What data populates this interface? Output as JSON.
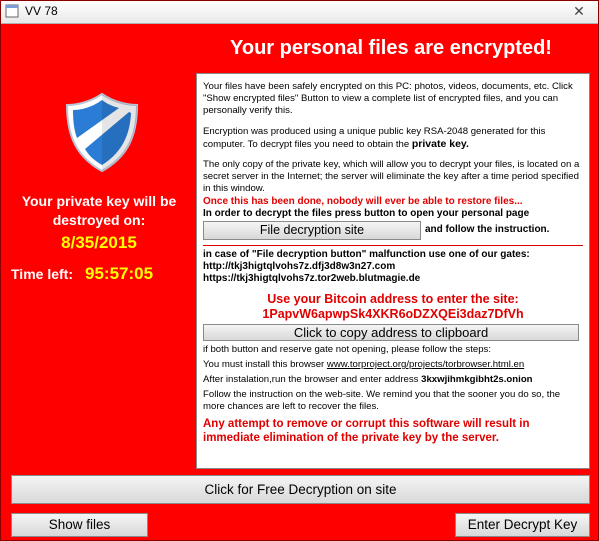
{
  "window": {
    "title": "VV 78",
    "close_glyph": "✕"
  },
  "header": {
    "headline": "Your personal files are encrypted!"
  },
  "left": {
    "key_destroyed_line1": "Your private key will be",
    "key_destroyed_line2": "destroyed on:",
    "date": "8/35/2015",
    "time_left_label": "Time left:",
    "time_left_value": "95:57:05"
  },
  "panel": {
    "p1": "Your files have been safely encrypted on this PC: photos, videos, documents, etc. Click \"Show encrypted files\" Button to view a complete list of encrypted files, and you can personally verify this.",
    "p2_text": "Encryption was produced using a unique public key RSA-2048 generated for this computer. To decrypt files you need to obtain the",
    "p2_bold": "private key.",
    "p3": "The only copy of the private key, which will allow you to decrypt your files, is located on a secret server in the Internet; the server will eliminate the key after a time period specified in this window.",
    "red_warning": "Once this has been done, nobody will ever be able to restore files...",
    "instruction": "In order to decrypt the files press button to open your personal page",
    "site_button": "File decryption site",
    "site_follow": "and follow the instruction.",
    "gates_intro": "in case of \"File decryption button\" malfunction use one of our gates:",
    "gate1": "http://tkj3higtqlvohs7z.dfj3d8w3n27.com",
    "gate2": "https://tkj3higtqlvohs7z.tor2web.blutmagie.de",
    "bitcoin_label": "Use your Bitcoin address to  enter the site:",
    "bitcoin_address": "1PapvW6apwpSk4XKR6oDZXQEi3daz7DfVh",
    "copy_button": "Click to copy address to clipboard",
    "steps_intro": "if both button and reserve gate not opening, please follow the steps:",
    "install_text": "You must install this browser",
    "install_link": "www.torproject.org/projects/torbrowser.html.en",
    "after_text": "After instalation,run the browser and enter address",
    "onion_address": "3kxwjihmkgibht2s.onion",
    "follow_text": "Follow the instruction on the web-site. We remind you that the sooner you do so, the more chances are left to recover the files.",
    "final_warning": "Any attempt to remove or corrupt this software will result in immediate elimination of the private key by the server."
  },
  "buttons": {
    "free_decryption": "Click for Free Decryption on site",
    "show_files": "Show files",
    "enter_key": "Enter Decrypt Key"
  },
  "colors": {
    "background_red": "#fe0000",
    "alert_yellow": "#ffff00",
    "warning_red": "#e00000",
    "shield_blue": "#2a7cd4"
  },
  "icons": {
    "title": "window-app-icon",
    "shield": "shield-icon"
  }
}
